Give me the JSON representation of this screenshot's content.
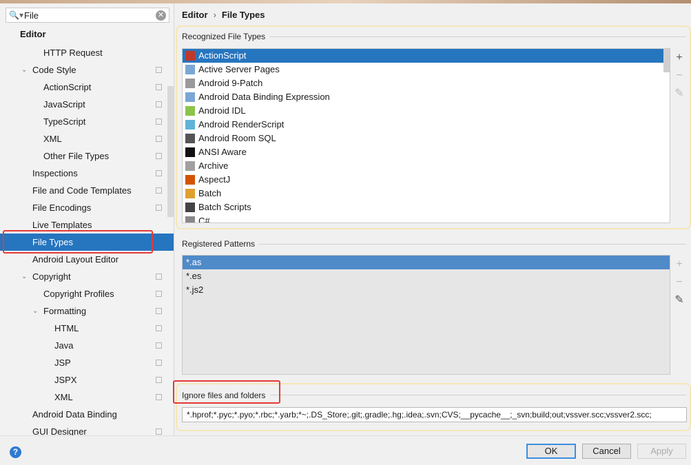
{
  "search": {
    "value": "File"
  },
  "sidebar": {
    "header": "Editor",
    "items": [
      {
        "label": "HTTP Request",
        "indent": 63,
        "arrow": "",
        "copy": false
      },
      {
        "label": "Code Style",
        "indent": 47,
        "arrow": "v",
        "copy": true
      },
      {
        "label": "ActionScript",
        "indent": 63,
        "arrow": "",
        "copy": true
      },
      {
        "label": "JavaScript",
        "indent": 63,
        "arrow": "",
        "copy": true
      },
      {
        "label": "TypeScript",
        "indent": 63,
        "arrow": "",
        "copy": true
      },
      {
        "label": "XML",
        "indent": 63,
        "arrow": "",
        "copy": true
      },
      {
        "label": "Other File Types",
        "indent": 63,
        "arrow": "",
        "copy": true
      },
      {
        "label": "Inspections",
        "indent": 47,
        "arrow": "",
        "copy": true
      },
      {
        "label": "File and Code Templates",
        "indent": 47,
        "arrow": "",
        "copy": true
      },
      {
        "label": "File Encodings",
        "indent": 47,
        "arrow": "",
        "copy": true
      },
      {
        "label": "Live Templates",
        "indent": 47,
        "arrow": "",
        "copy": false
      },
      {
        "label": "File Types",
        "indent": 47,
        "arrow": "",
        "copy": false,
        "selected": true
      },
      {
        "label": "Android Layout Editor",
        "indent": 47,
        "arrow": "",
        "copy": false
      },
      {
        "label": "Copyright",
        "indent": 47,
        "arrow": "v",
        "copy": true
      },
      {
        "label": "Copyright Profiles",
        "indent": 63,
        "arrow": "",
        "copy": true
      },
      {
        "label": "Formatting",
        "indent": 63,
        "arrow": "v",
        "copy": true
      },
      {
        "label": "HTML",
        "indent": 79,
        "arrow": "",
        "copy": true
      },
      {
        "label": "Java",
        "indent": 79,
        "arrow": "",
        "copy": true
      },
      {
        "label": "JSP",
        "indent": 79,
        "arrow": "",
        "copy": true
      },
      {
        "label": "JSPX",
        "indent": 79,
        "arrow": "",
        "copy": true
      },
      {
        "label": "XML",
        "indent": 79,
        "arrow": "",
        "copy": true
      },
      {
        "label": "Android Data Binding",
        "indent": 47,
        "arrow": "",
        "copy": false
      },
      {
        "label": "GUI Designer",
        "indent": 47,
        "arrow": "",
        "copy": true
      }
    ]
  },
  "breadcrumb": {
    "parent": "Editor",
    "separator": "›",
    "current": "File Types"
  },
  "recognized": {
    "label": "Recognized File Types",
    "items": [
      {
        "label": "ActionScript",
        "icon": "actionscript-icon",
        "color": "#c0392b",
        "selected": true
      },
      {
        "label": "Active Server Pages",
        "icon": "asp-icon",
        "color": "#7aa7d6"
      },
      {
        "label": "Android 9-Patch",
        "icon": "folder-icon",
        "color": "#9a9a9a"
      },
      {
        "label": "Android Data Binding Expression",
        "icon": "databinding-icon",
        "color": "#7aa7d6"
      },
      {
        "label": "Android IDL",
        "icon": "android-icon",
        "color": "#8bc34a"
      },
      {
        "label": "Android RenderScript",
        "icon": "renderscript-icon",
        "color": "#5fb3d9"
      },
      {
        "label": "Android Room SQL",
        "icon": "database-icon",
        "color": "#555555"
      },
      {
        "label": "ANSI Aware",
        "icon": "terminal-icon",
        "color": "#111111"
      },
      {
        "label": "Archive",
        "icon": "archive-icon",
        "color": "#a0a0a0"
      },
      {
        "label": "AspectJ",
        "icon": "aspectj-icon",
        "color": "#d35400"
      },
      {
        "label": "Batch",
        "icon": "gear-icon",
        "color": "#e0a030"
      },
      {
        "label": "Batch Scripts",
        "icon": "bat-icon",
        "color": "#444444"
      },
      {
        "label": "C#",
        "icon": "file-icon",
        "color": "#888888"
      }
    ]
  },
  "patterns": {
    "label": "Registered Patterns",
    "items": [
      {
        "label": "*.as",
        "selected": true
      },
      {
        "label": "*.es"
      },
      {
        "label": "*.js2"
      }
    ]
  },
  "tools": {
    "add": "+",
    "remove": "−",
    "edit": "✎"
  },
  "ignore": {
    "label": "Ignore files and folders",
    "value": "*.hprof;*.pyc;*.pyo;*.rbc;*.yarb;*~;.DS_Store;.git;.gradle;.hg;.idea;.svn;CVS;__pycache__;_svn;build;out;vssver.scc;vssver2.scc;"
  },
  "footer": {
    "help": "?",
    "ok": "OK",
    "cancel": "Cancel",
    "apply": "Apply"
  }
}
